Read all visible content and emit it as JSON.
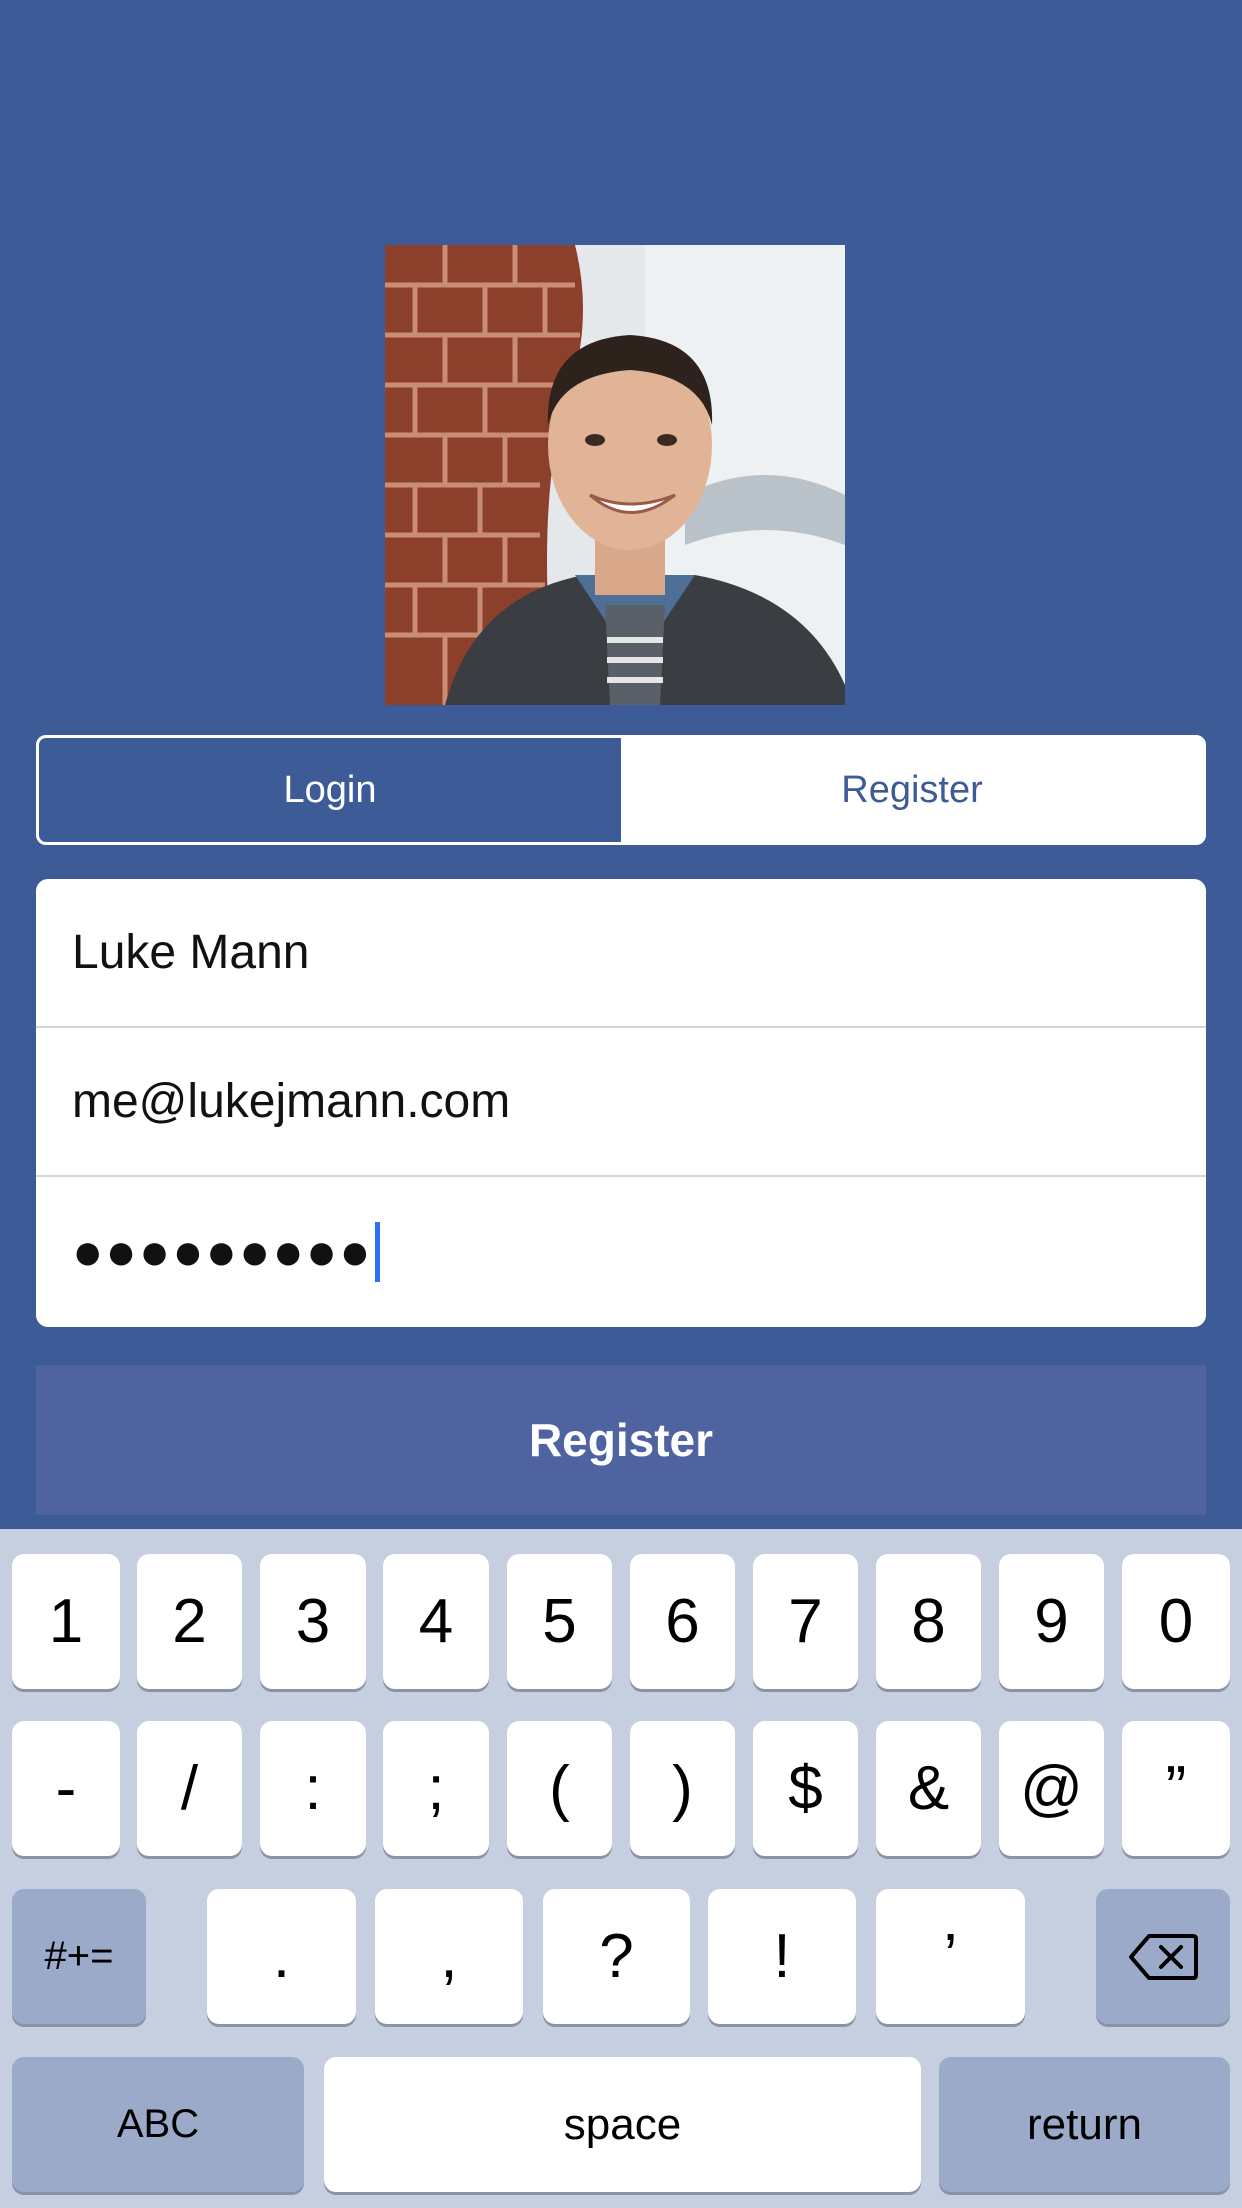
{
  "segmented_control": {
    "login_label": "Login",
    "register_label": "Register"
  },
  "form": {
    "name_value": "Luke Mann",
    "email_value": "me@lukejmann.com",
    "password_masked": "●●●●●●●●●"
  },
  "submit_button": {
    "label": "Register"
  },
  "keyboard": {
    "row1": [
      "1",
      "2",
      "3",
      "4",
      "5",
      "6",
      "7",
      "8",
      "9",
      "0"
    ],
    "row2": [
      "-",
      "/",
      ":",
      ";",
      "(",
      ")",
      "$",
      "&",
      "@",
      "”"
    ],
    "row3": [
      ".",
      ",",
      "?",
      "!",
      "’"
    ],
    "symbols_label": "#+=",
    "abc_label": "ABC",
    "space_label": "space",
    "return_label": "return"
  },
  "colors": {
    "background": "#3d5b96",
    "submit_button": "#4e63a0",
    "keyboard": "#c6cfdf",
    "dark_key": "#9aaac8",
    "cursor": "#2f6df6"
  }
}
